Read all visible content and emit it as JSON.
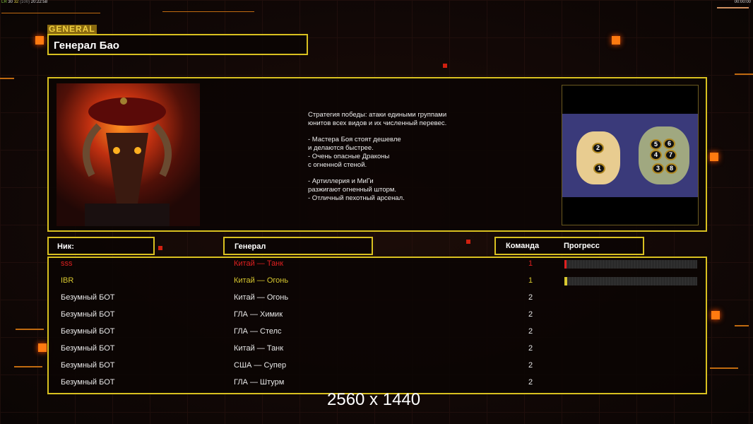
{
  "status_bar": {
    "a": "LR",
    "b": "30",
    "c": "32",
    "d": "(100)",
    "time": "20:22:58",
    "timer": "00:00:00"
  },
  "general_tag": "GENERAL",
  "general_name": "Генерал Бао",
  "description": "Стратегия победы: атаки едиными группами\nюнитов всех видов и их численный перевес.\n\n- Мастера Боя стоят дешевле\nи делаются быстрее.\n- Очень опасные Драконы\nс огненной стеной.\n\n- Артиллерия и МиГи\nразжигают огненный шторм.\n- Отличный пехотный арсенал.",
  "map_positions": [
    "1",
    "2",
    "3",
    "4",
    "5",
    "6",
    "7",
    "8"
  ],
  "headers": {
    "nick": "Ник:",
    "general": "Генерал",
    "team": "Команда",
    "progress": "Прогресс"
  },
  "players": [
    {
      "nick": "sss",
      "general": "Китай — Танк",
      "team": "1",
      "color": "#e02020",
      "progress": 0.01
    },
    {
      "nick": "IBR",
      "general": "Китай — Огонь",
      "team": "1",
      "color": "#d8c830",
      "progress": 0.02
    },
    {
      "nick": "Безумный БОТ",
      "general": "Китай — Огонь",
      "team": "2",
      "color": "#e8e8e8"
    },
    {
      "nick": "Безумный БОТ",
      "general": "ГЛА — Химик",
      "team": "2",
      "color": "#e8e8e8"
    },
    {
      "nick": "Безумный БОТ",
      "general": "ГЛА — Стелс",
      "team": "2",
      "color": "#e8e8e8"
    },
    {
      "nick": "Безумный БОТ",
      "general": "Китай — Танк",
      "team": "2",
      "color": "#e8e8e8"
    },
    {
      "nick": "Безумный БОТ",
      "general": "США — Супер",
      "team": "2",
      "color": "#e8e8e8"
    },
    {
      "nick": "Безумный БОТ",
      "general": "ГЛА — Штурм",
      "team": "2",
      "color": "#e8e8e8"
    }
  ],
  "resolution": "2560 x 1440"
}
